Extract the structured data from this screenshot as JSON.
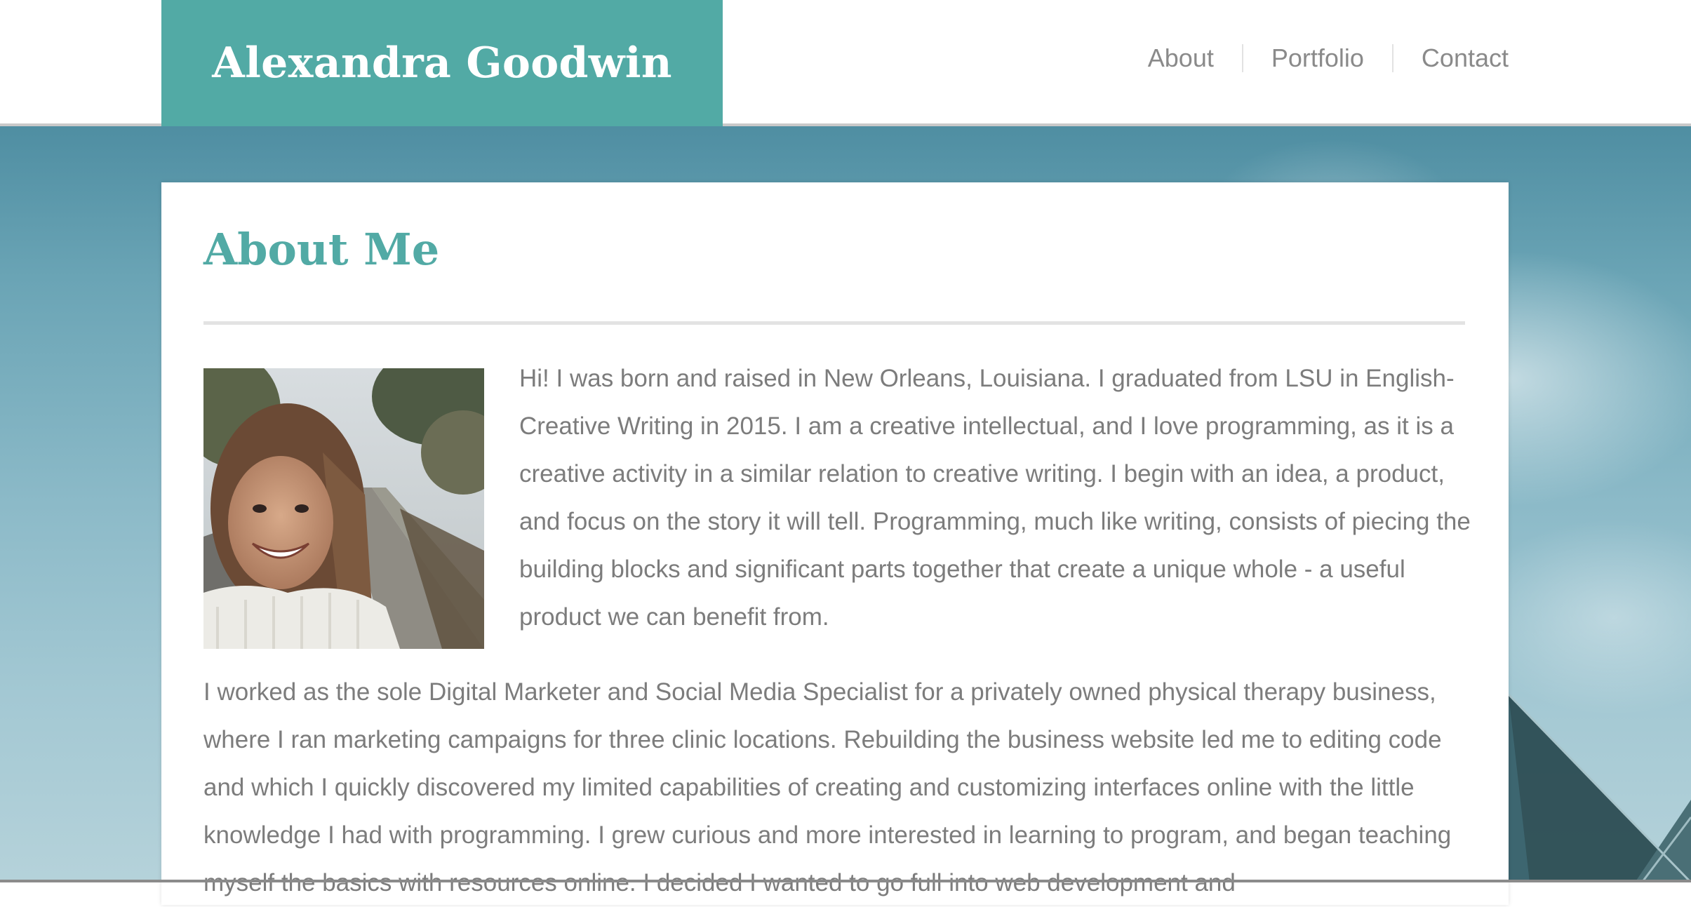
{
  "header": {
    "site_name": "Alexandra Goodwin",
    "nav": [
      "About",
      "Portfolio",
      "Contact"
    ]
  },
  "about": {
    "title": "About Me",
    "paragraphs": [
      "Hi! I was born and raised in New Orleans, Louisiana. I graduated from LSU in English-Creative Writing in 2015. I am a creative intellectual, and I love programming, as it is a creative activity in a similar relation to creative writing. I begin with an idea, a product, and focus on the story it will tell. Programming, much like writing, consists of piecing the building blocks and significant parts together that create a unique whole - a useful product we can benefit from.",
      "I worked as the sole Digital Marketer and Social Media Specialist for a privately owned physical therapy business, where I ran marketing campaigns for three clinic locations. Rebuilding the business website led me to editing code and which I quickly discovered my limited capabilities of creating and customizing interfaces online with the little knowledge I had with programming. I grew curious and more interested in learning to program, and began teaching myself the basics with resources online. I decided I wanted to go full into web development and"
    ]
  },
  "colors": {
    "brand": "#52aaa5",
    "nav_text": "#8a8a8a",
    "body_text": "#7c7c7c",
    "divider": "#e3e3e3"
  }
}
